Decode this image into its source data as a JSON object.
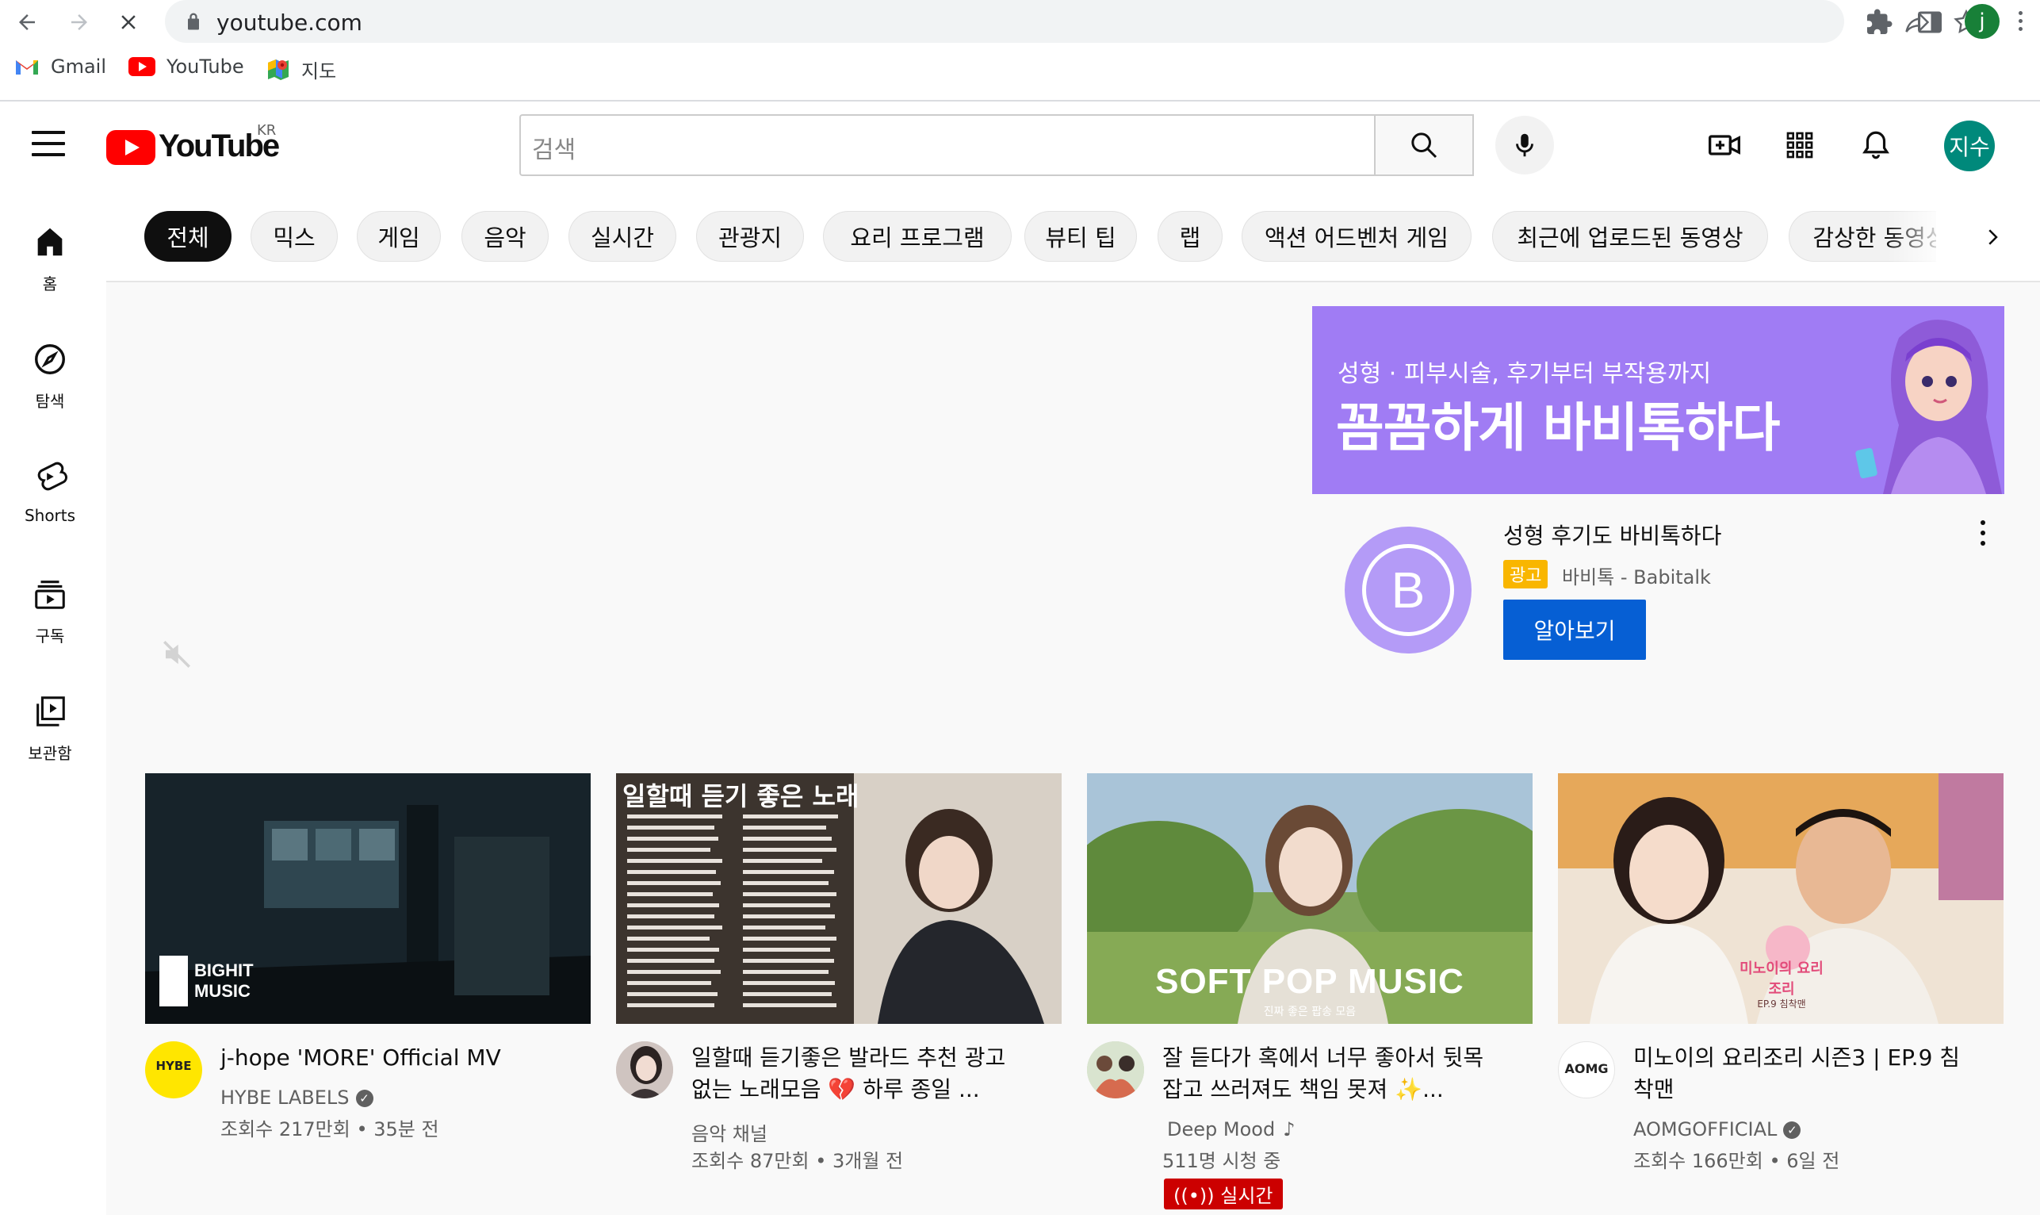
{
  "browser": {
    "url": "youtube.com",
    "profile_initial": "j",
    "bookmarks": [
      {
        "label": "Gmail",
        "icon": "gmail-icon"
      },
      {
        "label": "YouTube",
        "icon": "youtube-icon"
      },
      {
        "label": "지도",
        "icon": "maps-icon"
      }
    ]
  },
  "header": {
    "logo_text": "YouTube",
    "region": "KR",
    "search_placeholder": "검색",
    "avatar_text": "지수"
  },
  "chips": [
    "전체",
    "믹스",
    "게임",
    "음악",
    "실시간",
    "관광지",
    "요리 프로그램",
    "뷰티 팁",
    "랩",
    "액션 어드벤처 게임",
    "최근에 업로드된 동영상",
    "감상한 동영상"
  ],
  "sidebar": [
    {
      "label": "홈",
      "icon": "home-icon"
    },
    {
      "label": "탐색",
      "icon": "compass-icon"
    },
    {
      "label": "Shorts",
      "icon": "shorts-icon"
    },
    {
      "label": "구독",
      "icon": "subscriptions-icon"
    },
    {
      "label": "보관함",
      "icon": "library-icon"
    }
  ],
  "ad": {
    "banner_subtitle": "성형 · 피부시술, 후기부터 부작용까지",
    "banner_headline": "꼼꼼하게 바비톡하다",
    "logo_letter": "B",
    "title": "성형 후기도 바비톡하다",
    "badge": "광고",
    "advertiser": "바비톡 - Babitalk",
    "cta": "알아보기"
  },
  "videos": [
    {
      "title": "j-hope 'MORE' Official MV",
      "channel": "HYBE LABELS",
      "verified": true,
      "stats": "조회수 217만회 • 35분 전",
      "thumb_caption": "BIGHIT MUSIC",
      "avatar_text": "HYBE"
    },
    {
      "title": "일할때 듣기좋은 발라드 추천 광고없는 노래모음 💔 하루 종일 ...",
      "channel": "음악 채널",
      "verified": false,
      "stats": "조회수 87만회 • 3개월 전",
      "thumb_caption": "일할때 듣기 좋은 노래"
    },
    {
      "title": "잘 듣다가 혹에서 너무 좋아서 뒷목 잡고 쓰러져도 책임 못져 ✨...",
      "channel": "Deep Mood",
      "verified": false,
      "stats": "511명 시청 중",
      "live_badge": "실시간",
      "thumb_caption": "SOFT POP MUSIC",
      "thumb_subcaption": "진짜 좋은 팝송 모음"
    },
    {
      "title": "미노이의 요리조리 시즌3 | EP.9 침착맨",
      "channel": "AOMGOFFICIAL",
      "verified": true,
      "stats": "조회수 166만회 • 6일 전",
      "thumb_caption": "미노이의 요리조리",
      "thumb_subcaption": "EP.9 침착맨",
      "avatar_text": "AOMG"
    }
  ],
  "colors": {
    "brand_red": "#ff0000",
    "cta_blue": "#065fd4",
    "ad_purple": "#a07cf4",
    "live_red": "#cc0000",
    "ad_badge": "#f9b600"
  }
}
